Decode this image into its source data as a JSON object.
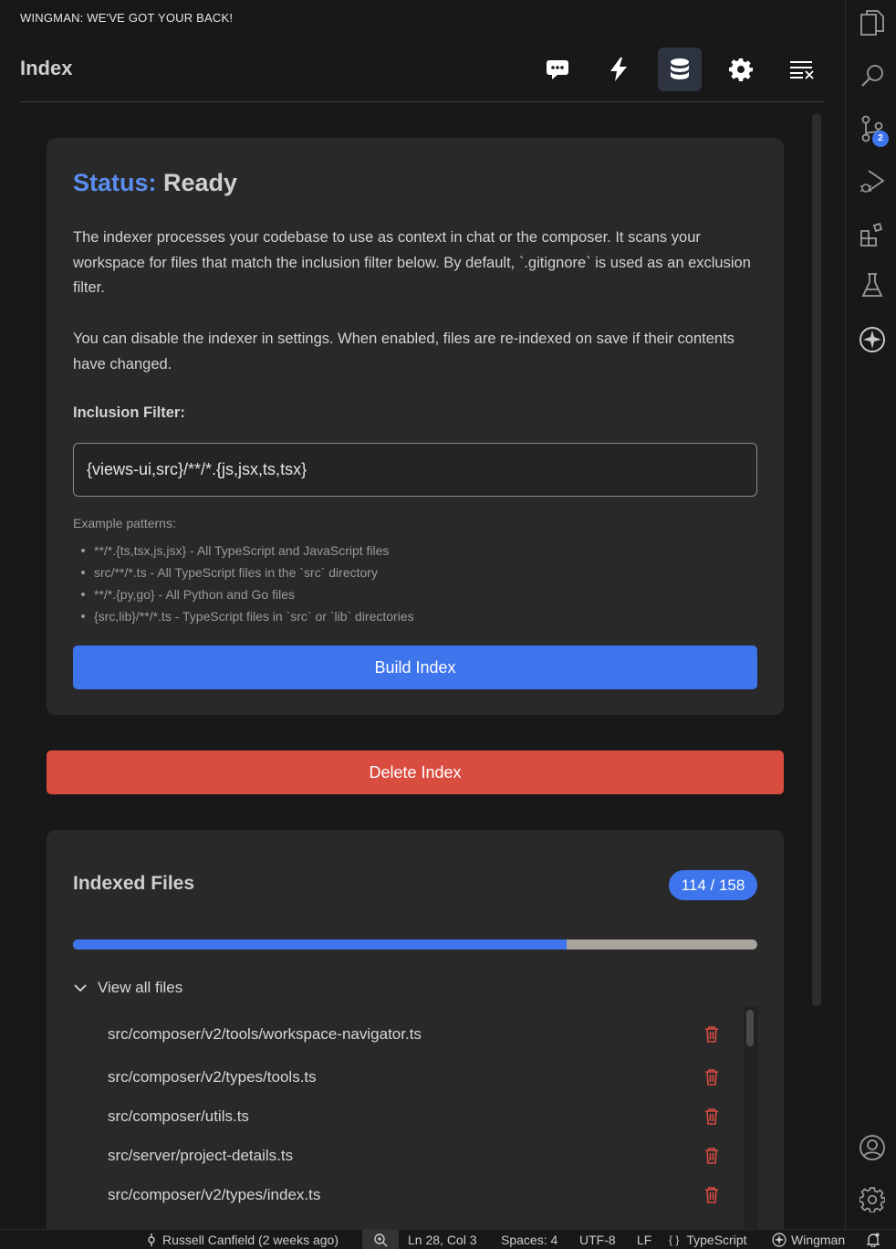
{
  "panel": {
    "title": "WINGMAN: WE'VE GOT YOUR BACK!"
  },
  "header": {
    "title": "Index",
    "buttons": [
      {
        "icon": "chat-icon"
      },
      {
        "icon": "lightning-icon"
      },
      {
        "icon": "database-icon",
        "active": true
      },
      {
        "icon": "gear-icon"
      },
      {
        "icon": "clear-list-icon"
      }
    ]
  },
  "status_card": {
    "status_key": "Status:",
    "status_value": "Ready",
    "description_1": "The indexer processes your codebase to use as context in chat or the composer. It scans your workspace for files that match the inclusion filter below. By default, `.gitignore` is used as an exclusion filter.",
    "description_2": "You can disable the indexer in settings. When enabled, files are re-indexed on save if their contents have changed.",
    "filter_label": "Inclusion Filter:",
    "filter_value": "{views-ui,src}/**/*.{js,jsx,ts,tsx}",
    "examples_title": "Example patterns:",
    "examples": [
      "**/*.{ts,tsx,js,jsx} - All TypeScript and JavaScript files",
      "src/**/*.ts - All TypeScript files in the `src` directory",
      "**/*.{py,go} - All Python and Go files",
      "{src,lib}/**/*.ts - TypeScript files in `src` or `lib` directories"
    ],
    "build_label": "Build Index"
  },
  "delete_label": "Delete Index",
  "files_card": {
    "title": "Indexed Files",
    "count_badge": "114 / 158",
    "progress_fraction": 0.7215,
    "view_all_label": "View all files",
    "files": [
      "src/composer/v2/tools/workspace-navigator.ts",
      "src/composer/v2/types/tools.ts",
      "src/composer/utils.ts",
      "src/server/project-details.ts",
      "src/composer/v2/types/index.ts"
    ]
  },
  "activity_bar": {
    "top": [
      "explorer-icon",
      "search-icon",
      "source-control-icon",
      "run-debug-icon",
      "extensions-icon",
      "testing-icon",
      "wingman-icon"
    ],
    "bottom": [
      "accounts-icon",
      "manage-gear-icon"
    ],
    "scm_badge": "2"
  },
  "statusbar": {
    "git_blame": "Russell Canfield (2 weeks ago)",
    "position": "Ln 28, Col 3",
    "spaces": "Spaces: 4",
    "encoding": "UTF-8",
    "eol": "LF",
    "language": "TypeScript",
    "language_prefix": "{ }",
    "wingman": "Wingman"
  },
  "colors": {
    "accent": "#3e74ec",
    "danger": "#d94c40",
    "status_key": "#5b8def"
  }
}
